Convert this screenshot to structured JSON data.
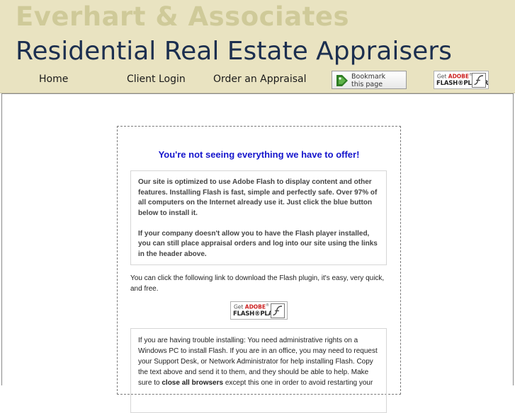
{
  "header": {
    "company": "Everhart & Associates",
    "tagline": "Residential Real Estate Appraisers",
    "nav": [
      {
        "label": "Home"
      },
      {
        "label": "Client Login"
      },
      {
        "label": "Order an Appraisal"
      }
    ],
    "bookmark": {
      "line1": "Bookmark",
      "line2": "this page"
    },
    "flash_badge": {
      "get": "Get",
      "adobe": "ADOBE",
      "reg": "®",
      "player": "FLASH®PLAYER"
    }
  },
  "panel": {
    "headline": "You're not seeing everything we have to offer!",
    "info1_p1": "Our site is optimized to use Adobe Flash to display content and other features. Installing Flash is fast, simple and perfectly safe. Over 97% of all computers on the Internet already use it. Just click the blue button below to install it.",
    "info1_p2": "If your company doesn't allow you to have the Flash player installed, you can still place appraisal orders and log into our site using the links in the header above.",
    "download_text": "You can click the following link to download the Flash plugin, it's easy, very quick, and free.",
    "info2_pre": "If you are having trouble installing: You need administrative rights on a Windows PC to install Flash. If you are in an office, you may need to request your Support Desk, or Network Administrator for help installing Flash. Copy the text above and send it to them, and they should be able to help. Make sure to ",
    "info2_bold": "close all browsers",
    "info2_post": " except this one in order to avoid restarting your"
  },
  "colors": {
    "header_bg": "#e9e3c1",
    "company_text": "#cfca99",
    "tagline_text": "#1c2f4f",
    "headline_blue": "#1515cc"
  },
  "icons": [
    "bookmark-star-icon",
    "flash-logo-icon"
  ]
}
